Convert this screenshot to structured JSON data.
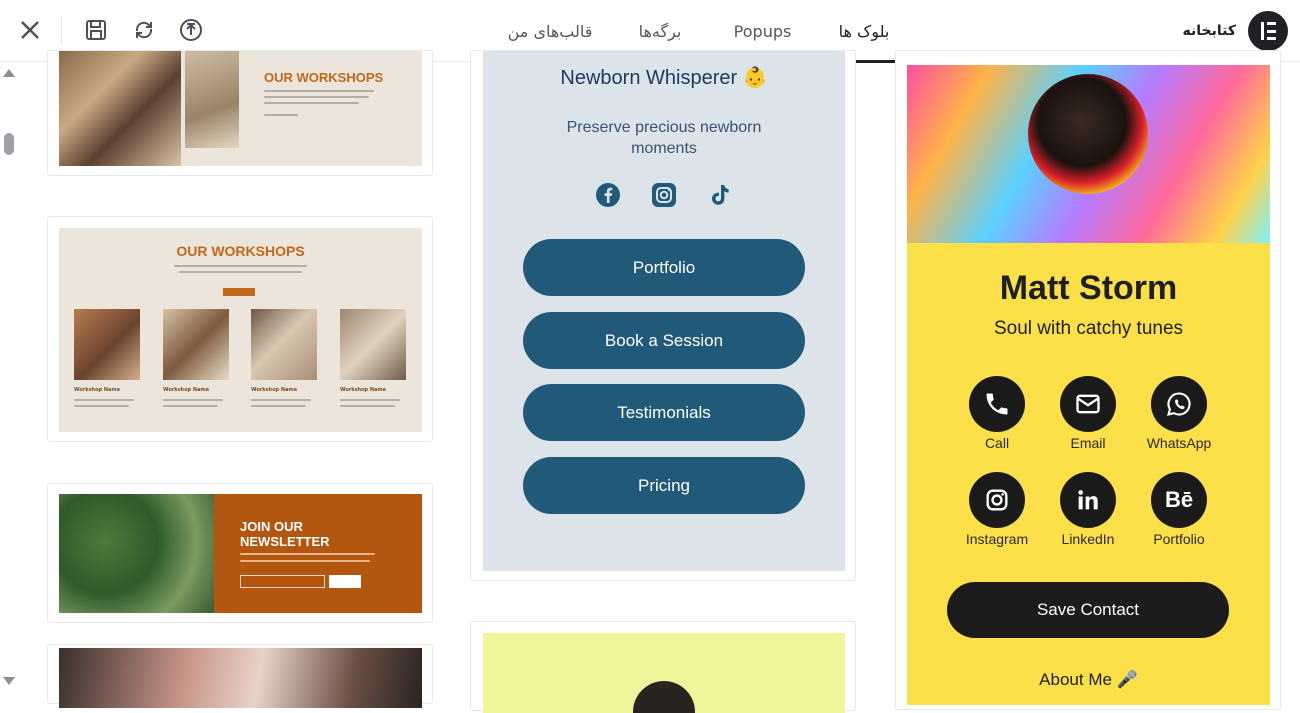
{
  "header": {
    "brand_title": "کتابخانه",
    "tabs": [
      {
        "label": "بلوک ها",
        "active": true
      },
      {
        "label": "Popups",
        "active": false
      },
      {
        "label": "برگه‌ها",
        "active": false
      },
      {
        "label": "قالب‌های من",
        "active": false
      }
    ],
    "icons": [
      "close-icon",
      "save-icon",
      "sync-icon",
      "upload-icon",
      "elementor-logo"
    ]
  },
  "column_left": {
    "card1": {
      "title": "OUR WORKSHOPS"
    },
    "card2": {
      "title": "OUR WORKSHOPS",
      "items": [
        "Workshop Name",
        "Workshop Name",
        "Workshop Name",
        "Workshop Name"
      ]
    },
    "card3": {
      "title_line1": "JOIN OUR",
      "title_line2": "NEWSLETTER"
    }
  },
  "column_middle": {
    "newborn": {
      "title": "Newborn Whisperer 👶",
      "subtitle_line1": "Preserve precious newborn",
      "subtitle_line2": "moments",
      "social_icons": [
        "facebook-icon",
        "instagram-icon",
        "tiktok-icon"
      ],
      "buttons": [
        "Portfolio",
        "Book a Session",
        "Testimonials",
        "Pricing"
      ]
    }
  },
  "column_right": {
    "matt": {
      "name": "Matt Storm",
      "tagline": "Soul with catchy tunes",
      "contacts": [
        "Call",
        "Email",
        "WhatsApp",
        "Instagram",
        "LinkedIn",
        "Portfolio"
      ],
      "save_button": "Save Contact",
      "about": "About Me 🎤"
    }
  },
  "colors": {
    "accent": "#1f2124",
    "workshop_orange": "#c0691a",
    "newsletter_bg": "#b3560f",
    "newborn_bg": "#dce4ea",
    "newborn_button": "#215a78",
    "matt_yellow": "#fbe04a"
  }
}
